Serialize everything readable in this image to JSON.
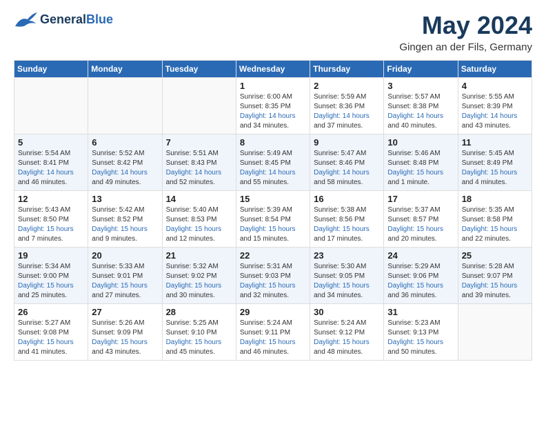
{
  "header": {
    "logo_general": "General",
    "logo_blue": "Blue",
    "month_title": "May 2024",
    "location": "Gingen an der Fils, Germany"
  },
  "calendar": {
    "days_of_week": [
      "Sunday",
      "Monday",
      "Tuesday",
      "Wednesday",
      "Thursday",
      "Friday",
      "Saturday"
    ],
    "weeks": [
      [
        {
          "day": "",
          "info": ""
        },
        {
          "day": "",
          "info": ""
        },
        {
          "day": "",
          "info": ""
        },
        {
          "day": "1",
          "info": "Sunrise: 6:00 AM\nSunset: 8:35 PM\nDaylight: 14 hours\nand 34 minutes."
        },
        {
          "day": "2",
          "info": "Sunrise: 5:59 AM\nSunset: 8:36 PM\nDaylight: 14 hours\nand 37 minutes."
        },
        {
          "day": "3",
          "info": "Sunrise: 5:57 AM\nSunset: 8:38 PM\nDaylight: 14 hours\nand 40 minutes."
        },
        {
          "day": "4",
          "info": "Sunrise: 5:55 AM\nSunset: 8:39 PM\nDaylight: 14 hours\nand 43 minutes."
        }
      ],
      [
        {
          "day": "5",
          "info": "Sunrise: 5:54 AM\nSunset: 8:41 PM\nDaylight: 14 hours\nand 46 minutes."
        },
        {
          "day": "6",
          "info": "Sunrise: 5:52 AM\nSunset: 8:42 PM\nDaylight: 14 hours\nand 49 minutes."
        },
        {
          "day": "7",
          "info": "Sunrise: 5:51 AM\nSunset: 8:43 PM\nDaylight: 14 hours\nand 52 minutes."
        },
        {
          "day": "8",
          "info": "Sunrise: 5:49 AM\nSunset: 8:45 PM\nDaylight: 14 hours\nand 55 minutes."
        },
        {
          "day": "9",
          "info": "Sunrise: 5:47 AM\nSunset: 8:46 PM\nDaylight: 14 hours\nand 58 minutes."
        },
        {
          "day": "10",
          "info": "Sunrise: 5:46 AM\nSunset: 8:48 PM\nDaylight: 15 hours\nand 1 minute."
        },
        {
          "day": "11",
          "info": "Sunrise: 5:45 AM\nSunset: 8:49 PM\nDaylight: 15 hours\nand 4 minutes."
        }
      ],
      [
        {
          "day": "12",
          "info": "Sunrise: 5:43 AM\nSunset: 8:50 PM\nDaylight: 15 hours\nand 7 minutes."
        },
        {
          "day": "13",
          "info": "Sunrise: 5:42 AM\nSunset: 8:52 PM\nDaylight: 15 hours\nand 9 minutes."
        },
        {
          "day": "14",
          "info": "Sunrise: 5:40 AM\nSunset: 8:53 PM\nDaylight: 15 hours\nand 12 minutes."
        },
        {
          "day": "15",
          "info": "Sunrise: 5:39 AM\nSunset: 8:54 PM\nDaylight: 15 hours\nand 15 minutes."
        },
        {
          "day": "16",
          "info": "Sunrise: 5:38 AM\nSunset: 8:56 PM\nDaylight: 15 hours\nand 17 minutes."
        },
        {
          "day": "17",
          "info": "Sunrise: 5:37 AM\nSunset: 8:57 PM\nDaylight: 15 hours\nand 20 minutes."
        },
        {
          "day": "18",
          "info": "Sunrise: 5:35 AM\nSunset: 8:58 PM\nDaylight: 15 hours\nand 22 minutes."
        }
      ],
      [
        {
          "day": "19",
          "info": "Sunrise: 5:34 AM\nSunset: 9:00 PM\nDaylight: 15 hours\nand 25 minutes."
        },
        {
          "day": "20",
          "info": "Sunrise: 5:33 AM\nSunset: 9:01 PM\nDaylight: 15 hours\nand 27 minutes."
        },
        {
          "day": "21",
          "info": "Sunrise: 5:32 AM\nSunset: 9:02 PM\nDaylight: 15 hours\nand 30 minutes."
        },
        {
          "day": "22",
          "info": "Sunrise: 5:31 AM\nSunset: 9:03 PM\nDaylight: 15 hours\nand 32 minutes."
        },
        {
          "day": "23",
          "info": "Sunrise: 5:30 AM\nSunset: 9:05 PM\nDaylight: 15 hours\nand 34 minutes."
        },
        {
          "day": "24",
          "info": "Sunrise: 5:29 AM\nSunset: 9:06 PM\nDaylight: 15 hours\nand 36 minutes."
        },
        {
          "day": "25",
          "info": "Sunrise: 5:28 AM\nSunset: 9:07 PM\nDaylight: 15 hours\nand 39 minutes."
        }
      ],
      [
        {
          "day": "26",
          "info": "Sunrise: 5:27 AM\nSunset: 9:08 PM\nDaylight: 15 hours\nand 41 minutes."
        },
        {
          "day": "27",
          "info": "Sunrise: 5:26 AM\nSunset: 9:09 PM\nDaylight: 15 hours\nand 43 minutes."
        },
        {
          "day": "28",
          "info": "Sunrise: 5:25 AM\nSunset: 9:10 PM\nDaylight: 15 hours\nand 45 minutes."
        },
        {
          "day": "29",
          "info": "Sunrise: 5:24 AM\nSunset: 9:11 PM\nDaylight: 15 hours\nand 46 minutes."
        },
        {
          "day": "30",
          "info": "Sunrise: 5:24 AM\nSunset: 9:12 PM\nDaylight: 15 hours\nand 48 minutes."
        },
        {
          "day": "31",
          "info": "Sunrise: 5:23 AM\nSunset: 9:13 PM\nDaylight: 15 hours\nand 50 minutes."
        },
        {
          "day": "",
          "info": ""
        }
      ]
    ]
  }
}
